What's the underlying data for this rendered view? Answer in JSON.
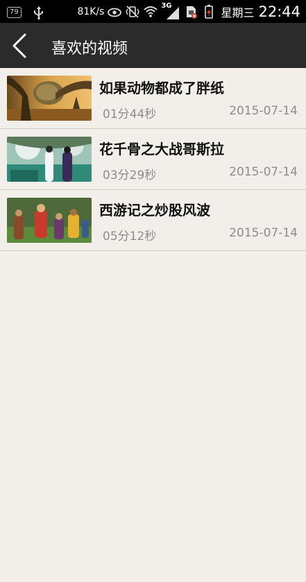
{
  "status_bar": {
    "battery_level_badge": "79",
    "net_speed": "81K/s",
    "network_type": "3G",
    "weekday": "星期三",
    "time": "22:44"
  },
  "header": {
    "title": "喜欢的视频"
  },
  "videos": [
    {
      "title": "如果动物都成了胖纸",
      "duration": "01分44秒",
      "date": "2015-07-14"
    },
    {
      "title": "花千骨之大战哥斯拉",
      "duration": "03分29秒",
      "date": "2015-07-14"
    },
    {
      "title": "西游记之炒股风波",
      "duration": "05分12秒",
      "date": "2015-07-14"
    }
  ],
  "colors": {
    "background": "#f2efeb",
    "header": "#2b2b2b",
    "status_bar": "#000000",
    "meta_text": "#8c8c8c"
  }
}
